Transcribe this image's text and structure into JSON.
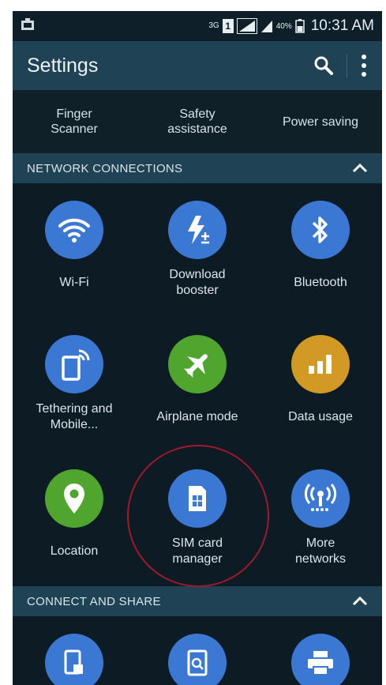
{
  "status_bar": {
    "net_type": "3G",
    "sim_badge": "1",
    "battery": "40%",
    "time": "10:31 AM"
  },
  "header": {
    "title": "Settings"
  },
  "quick_settings": [
    {
      "label": "Finger\nScanner"
    },
    {
      "label": "Safety\nassistance"
    },
    {
      "label": "Power saving"
    }
  ],
  "sections": {
    "network": {
      "title": "NETWORK CONNECTIONS"
    },
    "connect": {
      "title": "CONNECT AND SHARE"
    }
  },
  "network_items": [
    {
      "label": "Wi-Fi",
      "icon": "wifi-icon",
      "color": "#3b78d4"
    },
    {
      "label": "Download\nbooster",
      "icon": "download-booster-icon",
      "color": "#3b78d4"
    },
    {
      "label": "Bluetooth",
      "icon": "bluetooth-icon",
      "color": "#3b78d4"
    },
    {
      "label": "Tethering and\nMobile...",
      "icon": "tethering-icon",
      "color": "#3b78d4"
    },
    {
      "label": "Airplane mode",
      "icon": "airplane-icon",
      "color": "#4fa52e"
    },
    {
      "label": "Data usage",
      "icon": "data-usage-icon",
      "color": "#d29a25"
    },
    {
      "label": "Location",
      "icon": "location-icon",
      "color": "#4fa52e"
    },
    {
      "label": "SIM card\nmanager",
      "icon": "sim-card-icon",
      "color": "#3b78d4"
    },
    {
      "label": "More\nnetworks",
      "icon": "more-networks-icon",
      "color": "#3b78d4"
    }
  ],
  "connect_items": [
    {
      "icon": "nfc-icon",
      "color": "#3b78d4"
    },
    {
      "icon": "screen-mirroring-icon",
      "color": "#3b78d4"
    },
    {
      "icon": "printing-icon",
      "color": "#3b78d4"
    }
  ],
  "colors": {
    "background": "#0d1b24",
    "header": "#1f4354",
    "accent_blue": "#3b78d4",
    "accent_green": "#4fa52e",
    "accent_orange": "#d29a25",
    "annotation_circle": "#a3182a"
  }
}
